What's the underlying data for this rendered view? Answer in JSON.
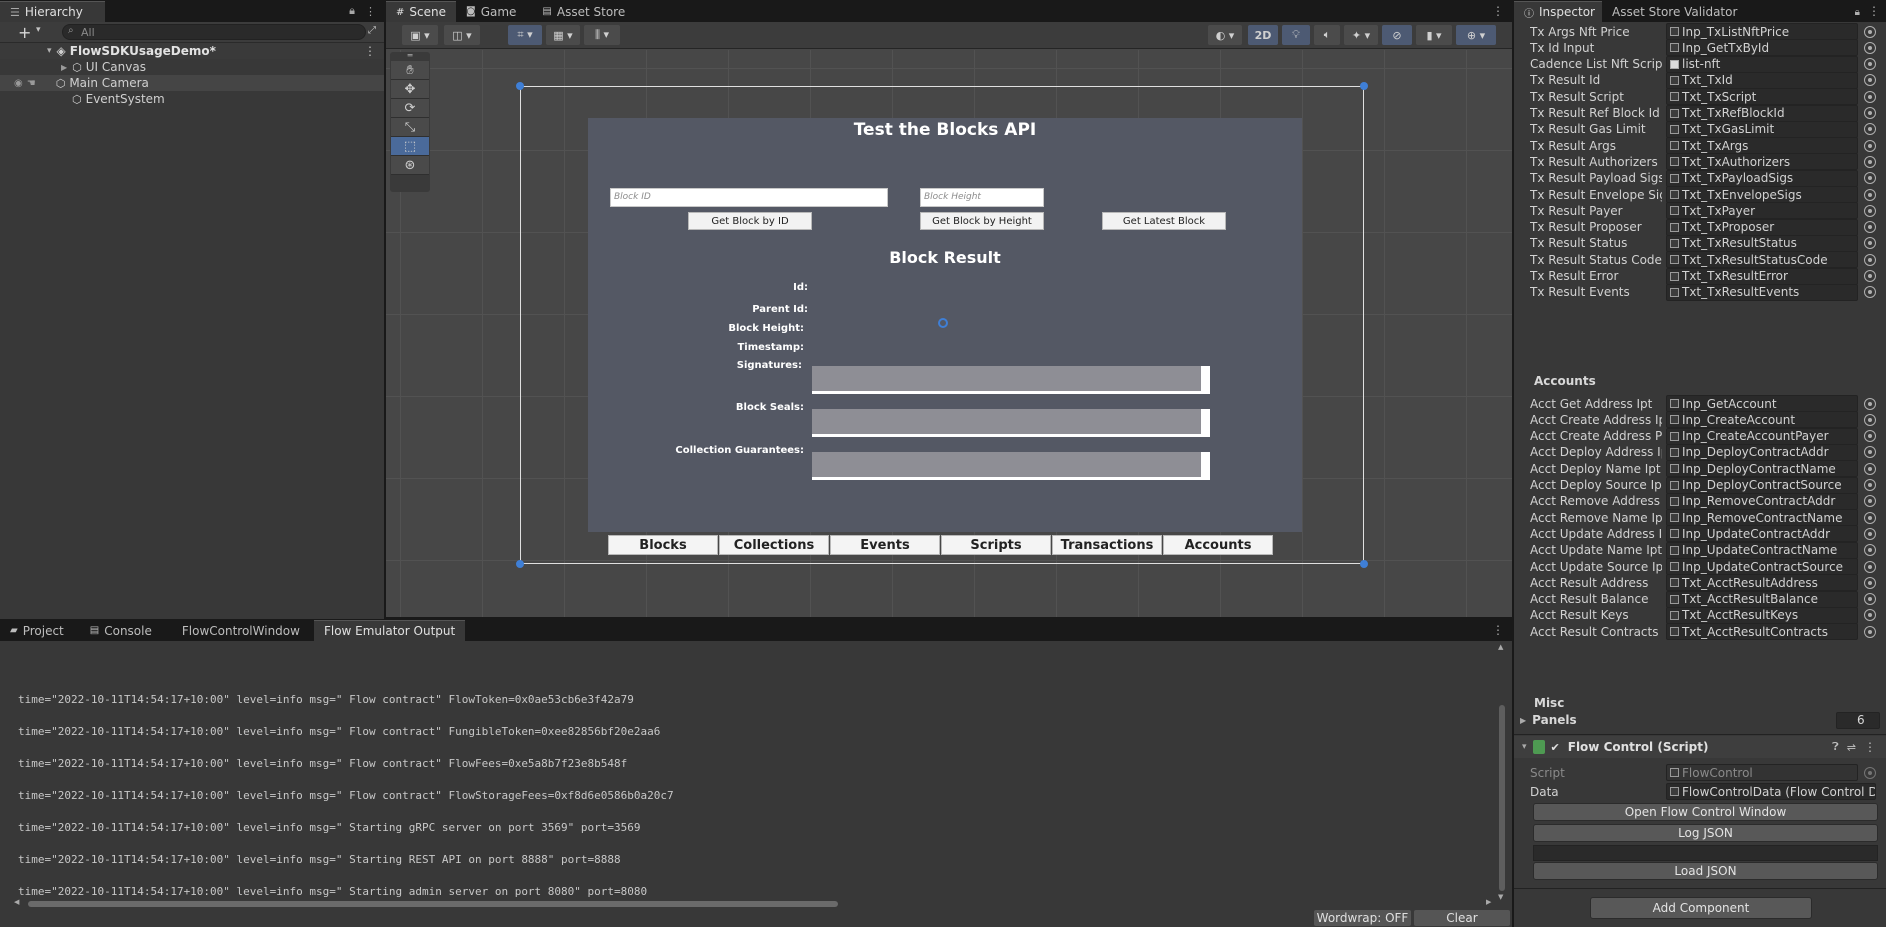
{
  "hierarchy": {
    "tab": "Hierarchy",
    "search_placeholder": "All",
    "scene_name": "FlowSDKUsageDemo*",
    "items": [
      "UI Canvas",
      "Main Camera",
      "EventSystem"
    ]
  },
  "scene_tabs": [
    "Scene",
    "Game",
    "Asset Store"
  ],
  "scene_toolbar": {
    "mode_2d": "2D"
  },
  "game_ui": {
    "title": "Test the Blocks API",
    "block_id_placeholder": "Block ID",
    "block_height_placeholder": "Block Height",
    "btn_get_by_id": "Get Block by ID",
    "btn_get_by_height": "Get Block by Height",
    "btn_get_latest": "Get Latest Block",
    "result_title": "Block Result",
    "labels": [
      "Id:",
      "Parent Id:",
      "Block Height:",
      "Timestamp:",
      "Signatures:",
      "Block Seals:",
      "Collection Guarantees:"
    ],
    "nav": [
      "Blocks",
      "Collections",
      "Events",
      "Scripts",
      "Transactions",
      "Accounts"
    ]
  },
  "bottom_tabs": [
    "Project",
    "Console",
    "FlowControlWindow",
    "Flow Emulator Output"
  ],
  "console": {
    "lines": [
      "time=\"2022-10-11T14:54:17+10:00\" level=info msg=\"  Flow contract\" FlowToken=0x0ae53cb6e3f42a79",
      "time=\"2022-10-11T14:54:17+10:00\" level=info msg=\"  Flow contract\" FungibleToken=0xee82856bf20e2aa6",
      "time=\"2022-10-11T14:54:17+10:00\" level=info msg=\"  Flow contract\" FlowFees=0xe5a8b7f23e8b548f",
      "time=\"2022-10-11T14:54:17+10:00\" level=info msg=\"  Flow contract\" FlowStorageFees=0xf8d6e0586b0a20c7",
      "time=\"2022-10-11T14:54:17+10:00\" level=info msg=\"  Starting gRPC server on port 3569\" port=3569",
      "time=\"2022-10-11T14:54:17+10:00\" level=info msg=\"  Starting REST API on port 8888\" port=8888",
      "time=\"2022-10-11T14:54:17+10:00\" level=info msg=\"  Starting admin server on port 8080\" port=8080"
    ],
    "wordwrap": "Wordwrap: OFF",
    "clear": "Clear"
  },
  "inspector": {
    "tabs": [
      "Inspector",
      "Asset Store Validator"
    ],
    "rows_tx": [
      [
        "Tx Args Nft Price",
        "Inp_TxListNftPrice",
        "sq"
      ],
      [
        "Tx Id Input",
        "Inp_GetTxById",
        "sq"
      ],
      [
        "Cadence List Nft Script",
        "list-nft",
        "doc"
      ],
      [
        "Tx Result Id",
        "Txt_TxId",
        "sq"
      ],
      [
        "Tx Result Script",
        "Txt_TxScript",
        "sq"
      ],
      [
        "Tx Result Ref Block Id",
        "Txt_TxRefBlockId",
        "sq"
      ],
      [
        "Tx Result Gas Limit",
        "Txt_TxGasLimit",
        "sq"
      ],
      [
        "Tx Result Args",
        "Txt_TxArgs",
        "sq"
      ],
      [
        "Tx Result Authorizers",
        "Txt_TxAuthorizers",
        "sq"
      ],
      [
        "Tx Result Payload Sigs",
        "Txt_TxPayloadSigs",
        "sq"
      ],
      [
        "Tx Result Envelope Sigs",
        "Txt_TxEnvelopeSigs",
        "sq"
      ],
      [
        "Tx Result Payer",
        "Txt_TxPayer",
        "sq"
      ],
      [
        "Tx Result Proposer",
        "Txt_TxProposer",
        "sq"
      ],
      [
        "Tx Result Status",
        "Txt_TxResultStatus",
        "sq"
      ],
      [
        "Tx Result Status Code",
        "Txt_TxResultStatusCode",
        "sq"
      ],
      [
        "Tx Result Error",
        "Txt_TxResultError",
        "sq"
      ],
      [
        "Tx Result Events",
        "Txt_TxResultEvents",
        "sq"
      ]
    ],
    "accounts_header": "Accounts",
    "rows_acct": [
      [
        "Acct Get Address Ipt",
        "Inp_GetAccount"
      ],
      [
        "Acct Create Address Ipt",
        "Inp_CreateAccount"
      ],
      [
        "Acct Create Address Pa",
        "Inp_CreateAccountPayer"
      ],
      [
        "Acct Deploy Address Ipt",
        "Inp_DeployContractAddr"
      ],
      [
        "Acct Deploy Name Ipt",
        "Inp_DeployContractName"
      ],
      [
        "Acct Deploy Source Ipt",
        "Inp_DeployContractSource"
      ],
      [
        "Acct Remove Address Ip",
        "Inp_RemoveContractAddr"
      ],
      [
        "Acct Remove Name Ipt",
        "Inp_RemoveContractName"
      ],
      [
        "Acct Update Address Ipt",
        "Inp_UpdateContractAddr"
      ],
      [
        "Acct Update Name Ipt",
        "Inp_UpdateContractName"
      ],
      [
        "Acct Update Source Ipt",
        "Inp_UpdateContractSource"
      ],
      [
        "Acct Result Address",
        "Txt_AcctResultAddress"
      ],
      [
        "Acct Result Balance",
        "Txt_AcctResultBalance"
      ],
      [
        "Acct Result Keys",
        "Txt_AcctResultKeys"
      ],
      [
        "Acct Result Contracts",
        "Txt_AcctResultContracts"
      ]
    ],
    "misc_header": "Misc",
    "panels_label": "Panels",
    "panels_value": "6",
    "component_title": "Flow Control (Script)",
    "script_label": "Script",
    "script_value": "FlowControl",
    "data_label": "Data",
    "data_value": "FlowControlData (Flow Control D",
    "btn_open_window": "Open Flow Control Window",
    "btn_log_json": "Log JSON",
    "btn_load_json": "Load JSON",
    "btn_add_component": "Add Component"
  }
}
